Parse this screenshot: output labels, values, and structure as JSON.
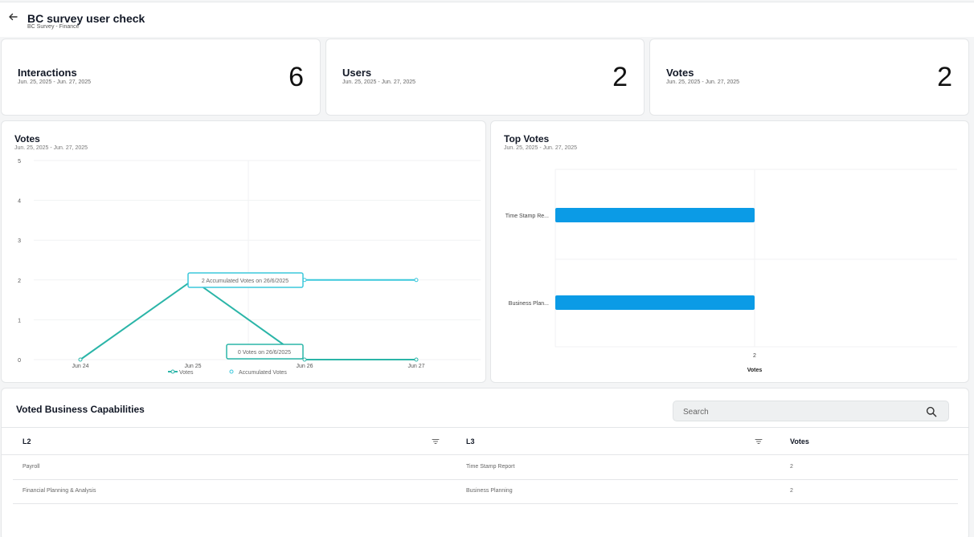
{
  "header": {
    "title": "BC survey user check",
    "subtitle": "BC Survey - Finance"
  },
  "stats": [
    {
      "label": "Interactions",
      "range": "Jun. 25, 2025 - Jun. 27, 2025",
      "value": "6"
    },
    {
      "label": "Users",
      "range": "Jun. 25, 2025 - Jun. 27, 2025",
      "value": "2"
    },
    {
      "label": "Votes",
      "range": "Jun. 25, 2025 - Jun. 27, 2025",
      "value": "2"
    }
  ],
  "votes_chart": {
    "title": "Votes",
    "range": "Jun. 25, 2025 - Jun. 27, 2025",
    "tooltip_accumulated": "2 Accumulated Votes on 26/6/2025",
    "tooltip_votes": "0 Votes on 26/6/2025"
  },
  "top_votes_chart": {
    "title": "Top Votes",
    "range": "Jun. 25, 2025 - Jun. 27, 2025"
  },
  "chart_data": [
    {
      "type": "line",
      "title": "Votes",
      "x": [
        "Jun 24",
        "Jun 25",
        "Jun 26",
        "Jun 27"
      ],
      "ylim": [
        0,
        5
      ],
      "yticks": [
        "0",
        "1",
        "2",
        "3",
        "4",
        "5"
      ],
      "series": [
        {
          "name": "Votes",
          "values": [
            0,
            2,
            0,
            0
          ],
          "color": "#2bb5a8"
        },
        {
          "name": "Accumulated Votes",
          "values": [
            0,
            2,
            2,
            2
          ],
          "color": "#3cc8dc"
        }
      ],
      "legend": "bottom"
    },
    {
      "type": "bar",
      "orientation": "horizontal",
      "title": "Top Votes",
      "categories": [
        "Time Stamp Re...",
        "Business Plan..."
      ],
      "values": [
        2,
        2
      ],
      "xticks": [
        "2"
      ],
      "xlabel": "Votes",
      "color": "#0b9be6"
    }
  ],
  "table": {
    "title": "Voted Business Capabilities",
    "search_placeholder": "Search",
    "headers": {
      "l2": "L2",
      "l3": "L3",
      "votes": "Votes"
    },
    "rows": [
      {
        "l2": "Payroll",
        "l3": "Time Stamp Report",
        "votes": "2"
      },
      {
        "l2": "Financial Planning & Analysis",
        "l3": "Business Planning",
        "votes": "2"
      }
    ]
  },
  "colors": {
    "accent_teal": "#2bb5a8",
    "accent_cyan": "#3cc8dc",
    "bar_blue": "#0b9be6"
  }
}
